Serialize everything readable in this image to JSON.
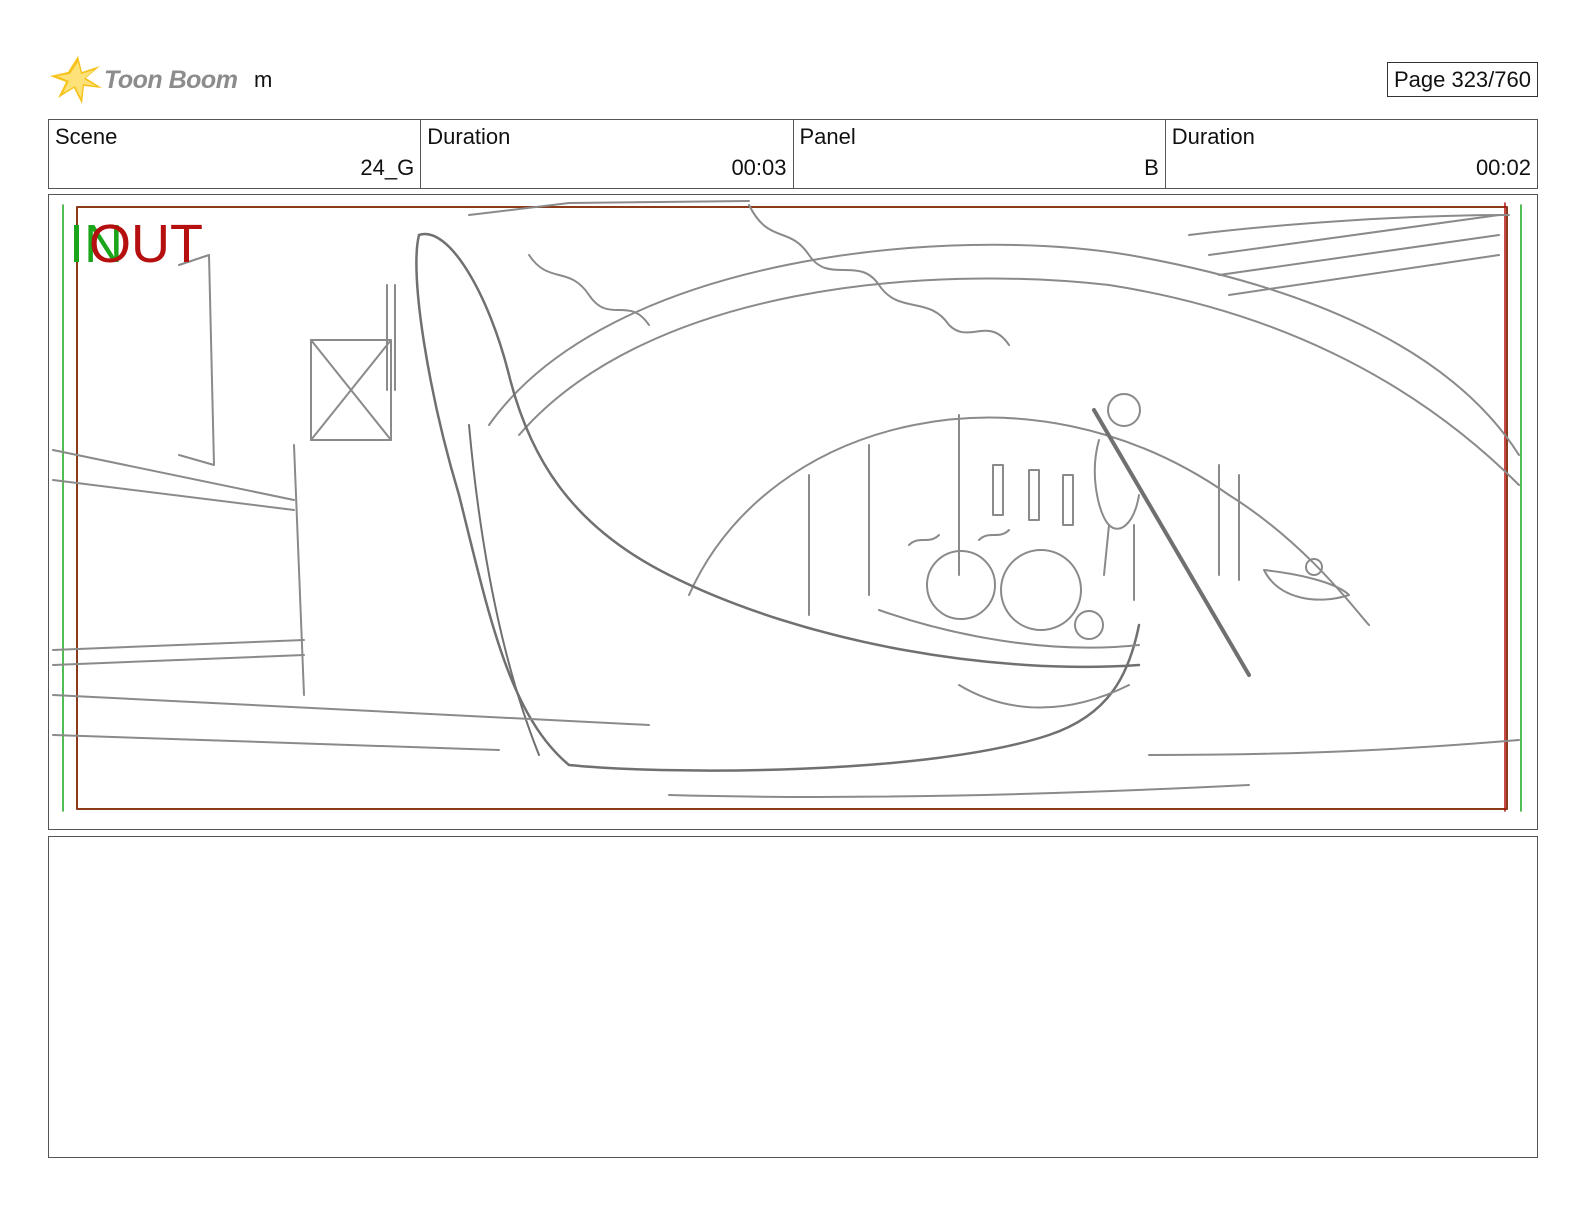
{
  "header": {
    "logo_icon": "toon-boom-star-icon",
    "logo_text": "Toon Boom",
    "project_name": "m",
    "page_counter": "Page 323/760"
  },
  "info": {
    "scene_label": "Scene",
    "scene_value": "24_G",
    "scene_duration_label": "Duration",
    "scene_duration_value": "00:03",
    "panel_label": "Panel",
    "panel_value": "B",
    "panel_duration_label": "Duration",
    "panel_duration_value": "00:02"
  },
  "panel": {
    "in_marker": "IN",
    "out_marker": "OUT",
    "in_color": "#1aa51a",
    "out_color": "#b50f0f"
  },
  "notes": {
    "text": ""
  }
}
